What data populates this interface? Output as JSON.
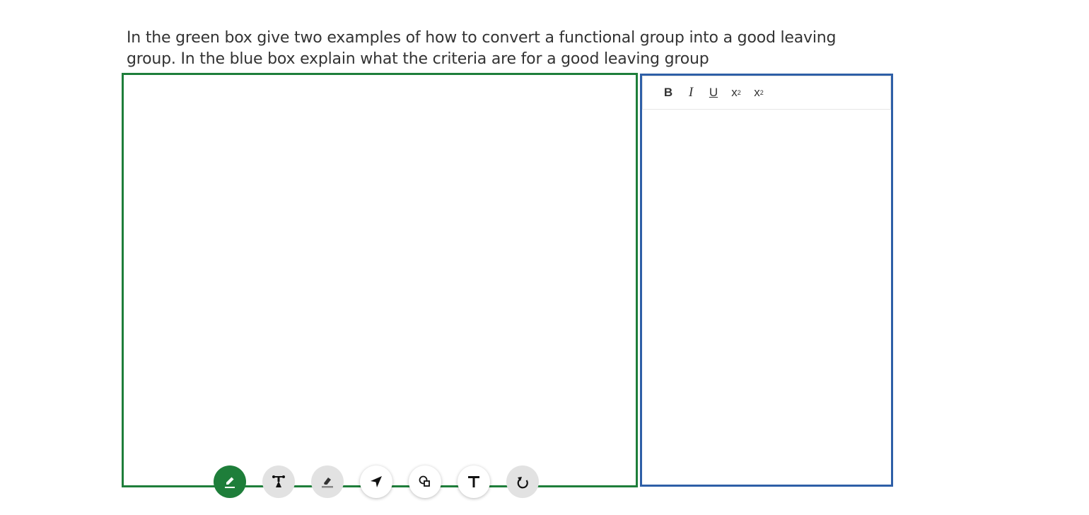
{
  "question": {
    "prompt": "In the green box give two examples of how to convert a functional group into a good leaving group. In the blue box explain what the criteria are for a good leaving group"
  },
  "drawing_canvas": {
    "border_color": "#1e7e3a",
    "tools": [
      {
        "name": "pencil-icon",
        "state": "active"
      },
      {
        "name": "line-tool-icon",
        "state": "idle"
      },
      {
        "name": "eraser-icon",
        "state": "idle"
      },
      {
        "name": "pointer-icon",
        "state": "idle"
      },
      {
        "name": "shapes-icon",
        "state": "idle"
      },
      {
        "name": "text-tool-icon",
        "state": "idle"
      },
      {
        "name": "undo-icon",
        "state": "idle"
      }
    ]
  },
  "text_editor": {
    "border_color": "#2e5fa7",
    "toolbar": {
      "bold": "B",
      "italic": "I",
      "underline": "U",
      "subscript_base": "x",
      "subscript_mark": "2",
      "superscript_base": "x",
      "superscript_mark": "2"
    },
    "content": ""
  }
}
